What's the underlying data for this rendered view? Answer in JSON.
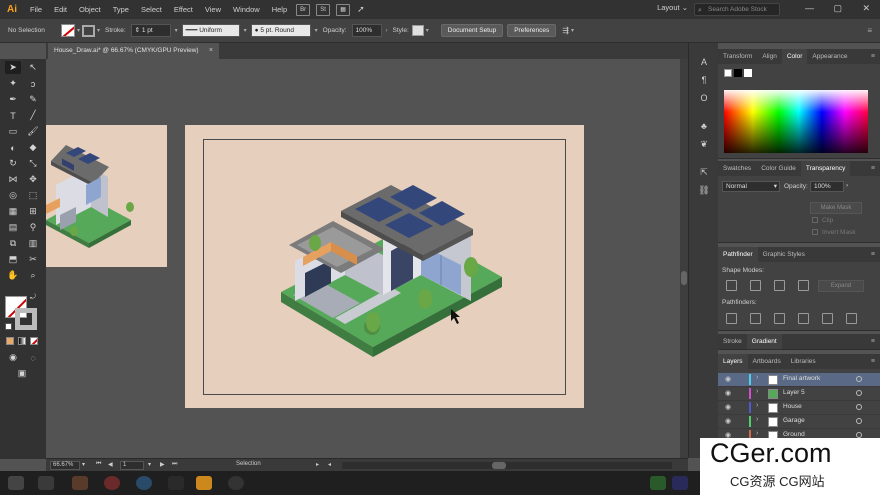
{
  "menubar": {
    "logo": "Ai",
    "items": [
      "File",
      "Edit",
      "Object",
      "Type",
      "Select",
      "Effect",
      "View",
      "Window",
      "Help"
    ],
    "bridge_icon": "Br",
    "stock_icon": "St",
    "workspace": "Layout",
    "search_placeholder": "Search Adobe Stock"
  },
  "controlbar": {
    "selection": "No Selection",
    "stroke_label": "Stroke:",
    "stroke_weight": "1 pt",
    "profile": "Uniform",
    "brush": "5 pt. Round",
    "opacity_label": "Opacity:",
    "opacity_value": "100%",
    "style_label": "Style:",
    "document_setup": "Document Setup",
    "preferences": "Preferences"
  },
  "document": {
    "tab_title": "House_Draw.ai* @ 66.67% (CMYK/GPU Preview)",
    "close": "×"
  },
  "panels": {
    "color_tabs": [
      "Transform",
      "Align",
      "Color",
      "Appearance"
    ],
    "color_active": "Color",
    "transparency_tabs": [
      "Swatches",
      "Color Guide",
      "Transparency"
    ],
    "transparency_active": "Transparency",
    "blend_mode": "Normal",
    "opacity_label": "Opacity:",
    "opacity_value": "100%",
    "make_mask": "Make Mask",
    "clip": "Clip",
    "invert_mask": "Invert Mask",
    "pathfinder_tabs": [
      "Pathfinder",
      "Graphic Styles"
    ],
    "pathfinder_active": "Pathfinder",
    "shape_modes": "Shape Modes:",
    "expand": "Expand",
    "pathfinders": "Pathfinders:",
    "gradient_tabs": [
      "Stroke",
      "Gradient"
    ],
    "gradient_active": "Gradient",
    "layers_tabs": [
      "Layers",
      "Artboards",
      "Libraries"
    ],
    "layers_active": "Layers",
    "layers": [
      {
        "name": "Final artwork",
        "color": "#4fd0e8"
      },
      {
        "name": "Layer 5",
        "color": "#d04fd0"
      },
      {
        "name": "House",
        "color": "#4f5ad0"
      },
      {
        "name": "Garage",
        "color": "#4fd06a"
      },
      {
        "name": "Ground",
        "color": "#d06a4f"
      }
    ]
  },
  "status": {
    "zoom": "66.67%",
    "artboard": "1",
    "mode": "Selection"
  },
  "watermark": {
    "title": "CGer.com",
    "subtitle": "CG资源 CG网站"
  },
  "colors": {
    "artboard": "#e7cfbd",
    "accent_orange": "#f7a21b"
  }
}
